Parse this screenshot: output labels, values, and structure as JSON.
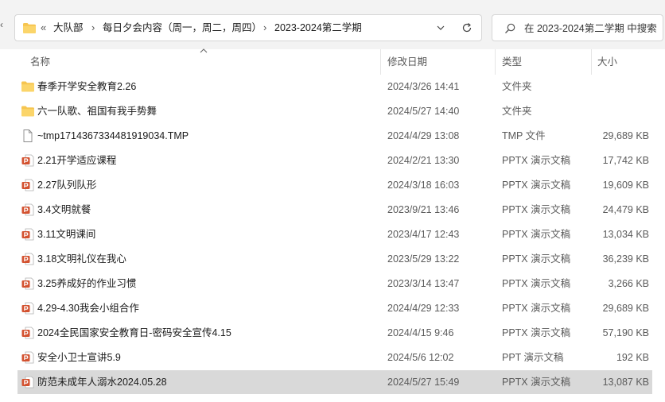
{
  "breadcrumb": {
    "overflow": "«",
    "items": [
      "大队部",
      "每日夕会内容（周一，周二，周四）",
      "2023-2024第二学期"
    ]
  },
  "search": {
    "placeholder": "在 2023-2024第二学期 中搜索"
  },
  "columns": {
    "name": "名称",
    "date": "修改日期",
    "type": "类型",
    "size": "大小"
  },
  "icons": {
    "folder": "folder-icon",
    "file": "file-icon",
    "pptx": "pptx-icon",
    "ppt": "ppt-icon",
    "refresh": "refresh-icon",
    "dropdown": "chevron-down-icon",
    "search": "search-icon",
    "sort": "sort-up-icon"
  },
  "colors": {
    "folder": "#f6c550",
    "ppt": "#d35230",
    "selected": "#d9d9d9"
  },
  "files": [
    {
      "name": "春季开学安全教育2.26",
      "date": "2024/3/26 14:41",
      "type": "文件夹",
      "size": "",
      "kind": "folder"
    },
    {
      "name": "六一队歌、祖国有我手势舞",
      "date": "2024/5/27 14:40",
      "type": "文件夹",
      "size": "",
      "kind": "folder"
    },
    {
      "name": "~tmp1714367334481919034.TMP",
      "date": "2024/4/29 13:08",
      "type": "TMP 文件",
      "size": "29,689 KB",
      "kind": "file"
    },
    {
      "name": "2.21开学适应课程",
      "date": "2024/2/21 13:30",
      "type": "PPTX 演示文稿",
      "size": "17,742 KB",
      "kind": "pptx"
    },
    {
      "name": "2.27队列队形",
      "date": "2024/3/18 16:03",
      "type": "PPTX 演示文稿",
      "size": "19,609 KB",
      "kind": "pptx"
    },
    {
      "name": "3.4文明就餐",
      "date": "2023/9/21 13:46",
      "type": "PPTX 演示文稿",
      "size": "24,479 KB",
      "kind": "pptx"
    },
    {
      "name": "3.11文明课间",
      "date": "2023/4/17 12:43",
      "type": "PPTX 演示文稿",
      "size": "13,034 KB",
      "kind": "pptx"
    },
    {
      "name": "3.18文明礼仪在我心",
      "date": "2023/5/29 13:22",
      "type": "PPTX 演示文稿",
      "size": "36,239 KB",
      "kind": "pptx"
    },
    {
      "name": "3.25养成好的作业习惯",
      "date": "2023/3/14 13:47",
      "type": "PPTX 演示文稿",
      "size": "3,266 KB",
      "kind": "pptx"
    },
    {
      "name": "4.29-4.30我会小组合作",
      "date": "2024/4/29 12:33",
      "type": "PPTX 演示文稿",
      "size": "29,689 KB",
      "kind": "pptx"
    },
    {
      "name": "2024全民国家安全教育日-密码安全宣传4.15",
      "date": "2024/4/15 9:46",
      "type": "PPTX 演示文稿",
      "size": "57,190 KB",
      "kind": "pptx"
    },
    {
      "name": "安全小卫士宣讲5.9",
      "date": "2024/5/6 12:02",
      "type": "PPT 演示文稿",
      "size": "192 KB",
      "kind": "ppt"
    },
    {
      "name": "防范未成年人溺水2024.05.28",
      "date": "2024/5/27 15:49",
      "type": "PPTX 演示文稿",
      "size": "13,087 KB",
      "kind": "pptx",
      "selected": true
    }
  ]
}
